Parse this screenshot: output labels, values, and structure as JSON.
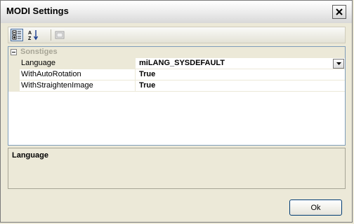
{
  "window": {
    "title": "MODI Settings"
  },
  "toolbar": {
    "buttons": [
      {
        "icon": "categorized-icon",
        "active": true
      },
      {
        "icon": "alphabetical-icon",
        "active": false
      },
      {
        "icon": "property-pages-icon",
        "active": false
      }
    ]
  },
  "grid": {
    "category": "Sonstiges",
    "properties": [
      {
        "name": "Language",
        "value": "miLANG_SYSDEFAULT",
        "selected": true
      },
      {
        "name": "WithAutoRotation",
        "value": "True",
        "selected": false
      },
      {
        "name": "WithStraightenImage",
        "value": "True",
        "selected": false
      }
    ]
  },
  "help": {
    "title": "Language"
  },
  "buttons": {
    "ok": "Ok"
  }
}
